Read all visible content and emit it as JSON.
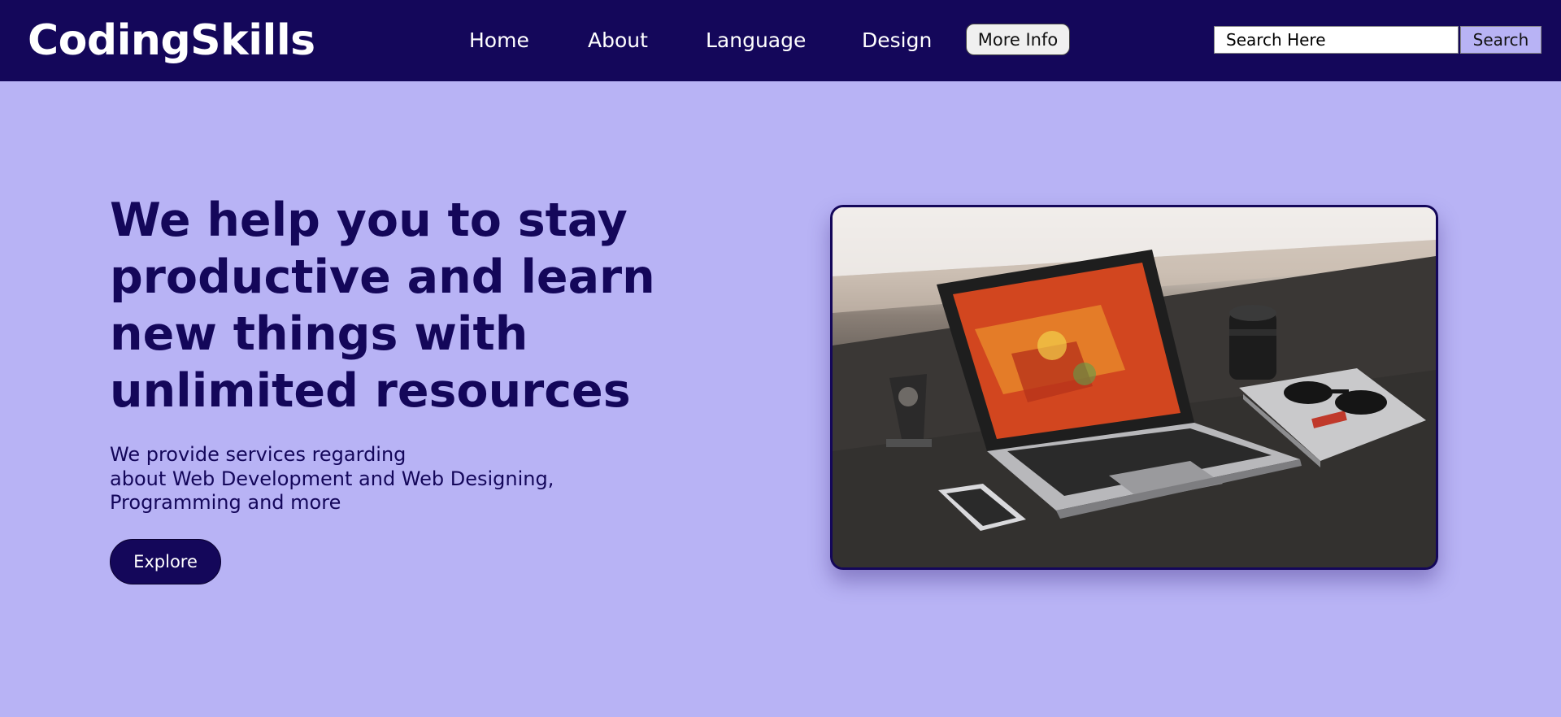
{
  "header": {
    "brand": "CodingSkills",
    "nav": {
      "home": "Home",
      "about": "About",
      "language": "Language",
      "design": "Design"
    },
    "more_info_label": "More Info",
    "search": {
      "placeholder": "Search Here",
      "button_label": "Search"
    }
  },
  "hero": {
    "headline": "We help you to stay productive and learn new things with unlimited resources",
    "description": [
      "We provide services regarding",
      "about Web Development and Web Designing,",
      "Programming and more"
    ],
    "explore_label": "Explore",
    "image_icon": "laptop-on-desk-photo"
  },
  "colors": {
    "navbar_bg": "#14075a",
    "page_bg": "#b8b3f5",
    "text_primary": "#14075a",
    "text_on_dark": "#ffffff"
  }
}
